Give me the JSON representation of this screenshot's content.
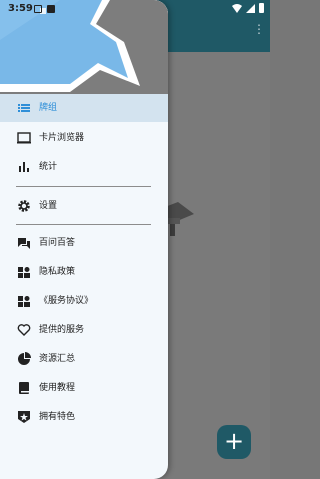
{
  "status_bar": {
    "time": "3:59"
  },
  "drawer": {
    "primary_items": [
      {
        "label": "牌组",
        "icon": "list-icon",
        "active": true
      },
      {
        "label": "卡片浏览器",
        "icon": "browser-window-icon",
        "active": false
      },
      {
        "label": "统计",
        "icon": "bar-chart-icon",
        "active": false
      }
    ],
    "settings_label": "设置",
    "secondary_items": [
      {
        "label": "百问百答",
        "icon": "forum-icon"
      },
      {
        "label": "隐私政策",
        "icon": "policy-icon"
      },
      {
        "label": "《服务协议》",
        "icon": "agreement-icon"
      },
      {
        "label": "提供的服务",
        "icon": "heart-icon"
      },
      {
        "label": "资源汇总",
        "icon": "pie-chart-icon"
      },
      {
        "label": "使用教程",
        "icon": "book-icon"
      },
      {
        "label": "拥有特色",
        "icon": "star-badge-icon"
      }
    ]
  },
  "fab": {
    "label": "+"
  },
  "colors": {
    "accent": "#2f8fd8",
    "toolbar": "#1f5966",
    "active_bg": "#d3e3ef",
    "drawer_bg": "#f3f8fc",
    "header_blue": "#79b8e8"
  }
}
